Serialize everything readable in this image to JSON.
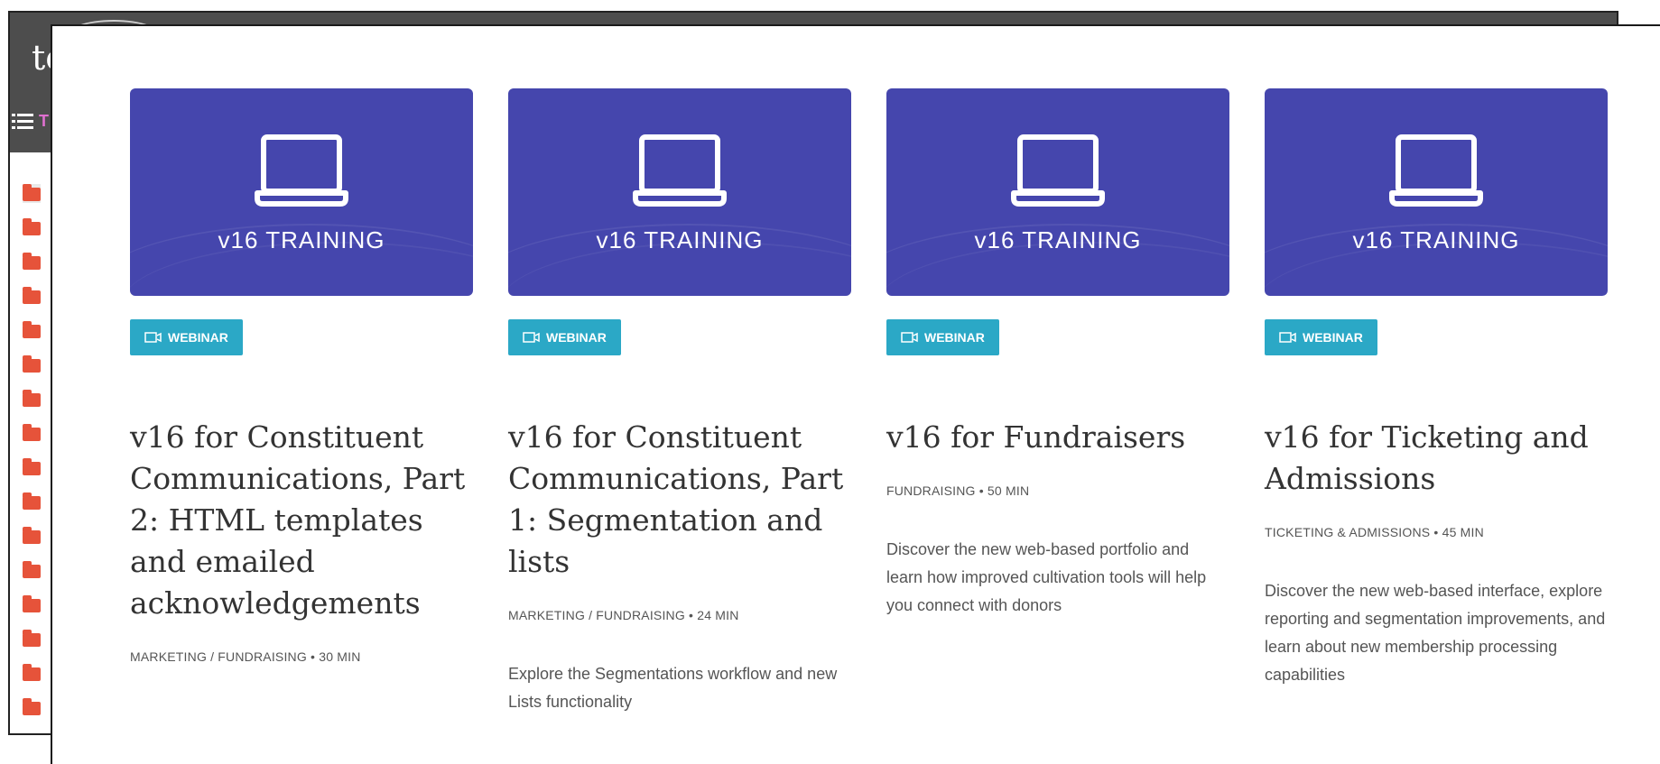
{
  "background_app": {
    "logo_partial": "te",
    "menu_partial": "T",
    "folder_count": 16
  },
  "cards": [
    {
      "thumbnail_title": "v16 TRAINING",
      "badge": "WEBINAR",
      "title": "v16 for Constituent Communications, Part 2: HTML templates and emailed acknowledgements",
      "meta": "MARKETING / FUNDRAISING • 30 MIN",
      "description": ""
    },
    {
      "thumbnail_title": "v16 TRAINING",
      "badge": "WEBINAR",
      "title": "v16 for Constituent Communications, Part 1: Segmentation and lists",
      "meta": "MARKETING / FUNDRAISING • 24 MIN",
      "description": "Explore the Segmentations workflow and new Lists functionality"
    },
    {
      "thumbnail_title": "v16 TRAINING",
      "badge": "WEBINAR",
      "title": "v16 for Fundraisers",
      "meta": "FUNDRAISING • 50 MIN",
      "description": "Discover the new web-based portfolio and learn how improved cultivation tools will help you connect with donors"
    },
    {
      "thumbnail_title": "v16 TRAINING",
      "badge": "WEBINAR",
      "title": "v16 for Ticketing and Admissions",
      "meta": "TICKETING & ADMISSIONS • 45 MIN",
      "description": "Discover the new web-based interface, explore reporting and segmentation improvements, and learn about new membership processing capabilities"
    }
  ],
  "colors": {
    "thumbnail_bg": "#4546ad",
    "badge_bg": "#2ba8c6",
    "folder": "#e6533a",
    "bg_header": "#4d4d4d"
  },
  "icons": {
    "thumbnail": "laptop-icon",
    "badge": "video-camera-icon",
    "folder": "folder-icon",
    "menu": "list-menu-icon"
  }
}
